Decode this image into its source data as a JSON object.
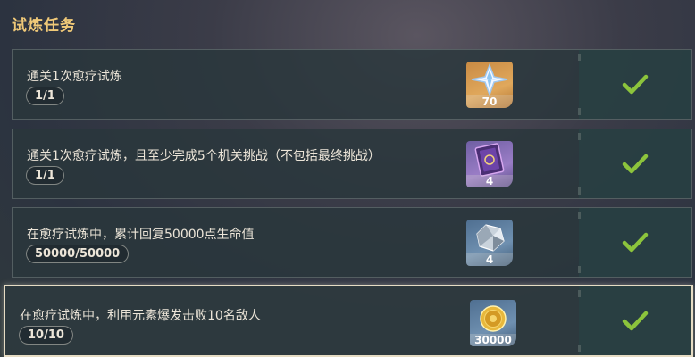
{
  "title": "试炼任务",
  "quests": [
    {
      "description": "通关1次愈疗试炼",
      "progress": "1/1",
      "reward": {
        "icon": "primogem-icon",
        "qty": "70",
        "tier_color": "#c98a43"
      },
      "completed": true
    },
    {
      "description": "通关1次愈疗试炼，且至少完成5个机关挑战（不包括最终挑战）",
      "progress": "1/1",
      "reward": {
        "icon": "heros-wit-book-icon",
        "qty": "4",
        "tier_color": "#8a6fc0"
      },
      "completed": true
    },
    {
      "description": "在愈疗试炼中，累计回复50000点生命值",
      "progress": "50000/50000",
      "reward": {
        "icon": "mystic-enhancement-ore-icon",
        "qty": "4",
        "tier_color": "#5f80a3"
      },
      "completed": true
    },
    {
      "description": "在愈疗试炼中，利用元素爆发击败10名敌人",
      "progress": "10/10",
      "reward": {
        "icon": "mora-icon",
        "qty": "30000",
        "tier_color": "#5f80a3"
      },
      "completed": true
    }
  ],
  "colors": {
    "title": "#f0c978",
    "check": "#8cc43c"
  }
}
